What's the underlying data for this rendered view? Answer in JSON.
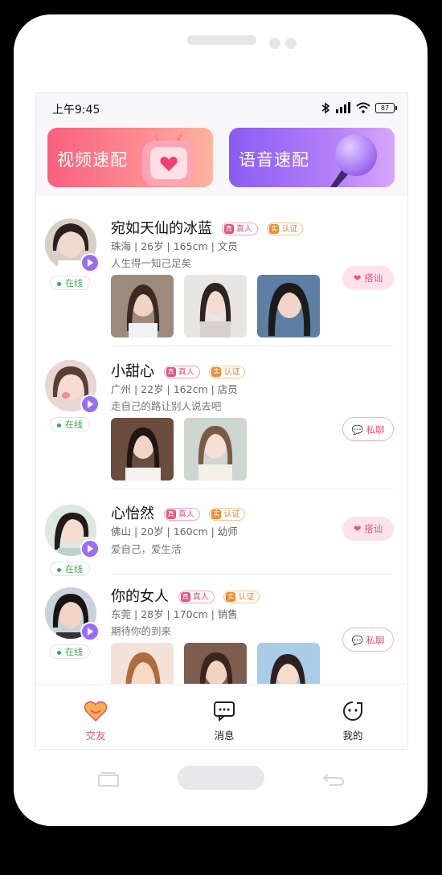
{
  "status_bar": {
    "time": "上午9:45",
    "battery": "87"
  },
  "banners": {
    "video": {
      "label": "视频速配"
    },
    "voice": {
      "label": "语音速配"
    }
  },
  "tags": {
    "real": "真人",
    "real_icon": "真",
    "auth": "认证",
    "auth_icon": "实"
  },
  "online_label": "在线",
  "users": [
    {
      "name": "宛如天仙的冰蓝",
      "info": "珠海 | 26岁 | 165cm | 文员",
      "motto": "人生得一知己足矣",
      "action": "搭讪",
      "photo_count": 3
    },
    {
      "name": "小甜心",
      "info": "广州 | 22岁 | 162cm | 店员",
      "motto": "走自己的路让别人说去吧",
      "action": "私聊",
      "photo_count": 2
    },
    {
      "name": "心怡然",
      "info": "佛山 | 20岁 | 160cm | 幼师",
      "motto": "爱自己，爱生活",
      "action": "搭讪",
      "photo_count": 0
    },
    {
      "name": "你的女人",
      "info": "东莞 | 28岁 | 170cm | 销售",
      "motto": "期待你的到来",
      "action": "私聊",
      "photo_count": 3
    }
  ],
  "tabbar": [
    {
      "label": "交友",
      "icon": "heart-face-icon",
      "active": true,
      "color": "#e5547d"
    },
    {
      "label": "消息",
      "icon": "message-icon",
      "active": false
    },
    {
      "label": "我的",
      "icon": "smile-face-icon",
      "active": false
    }
  ]
}
